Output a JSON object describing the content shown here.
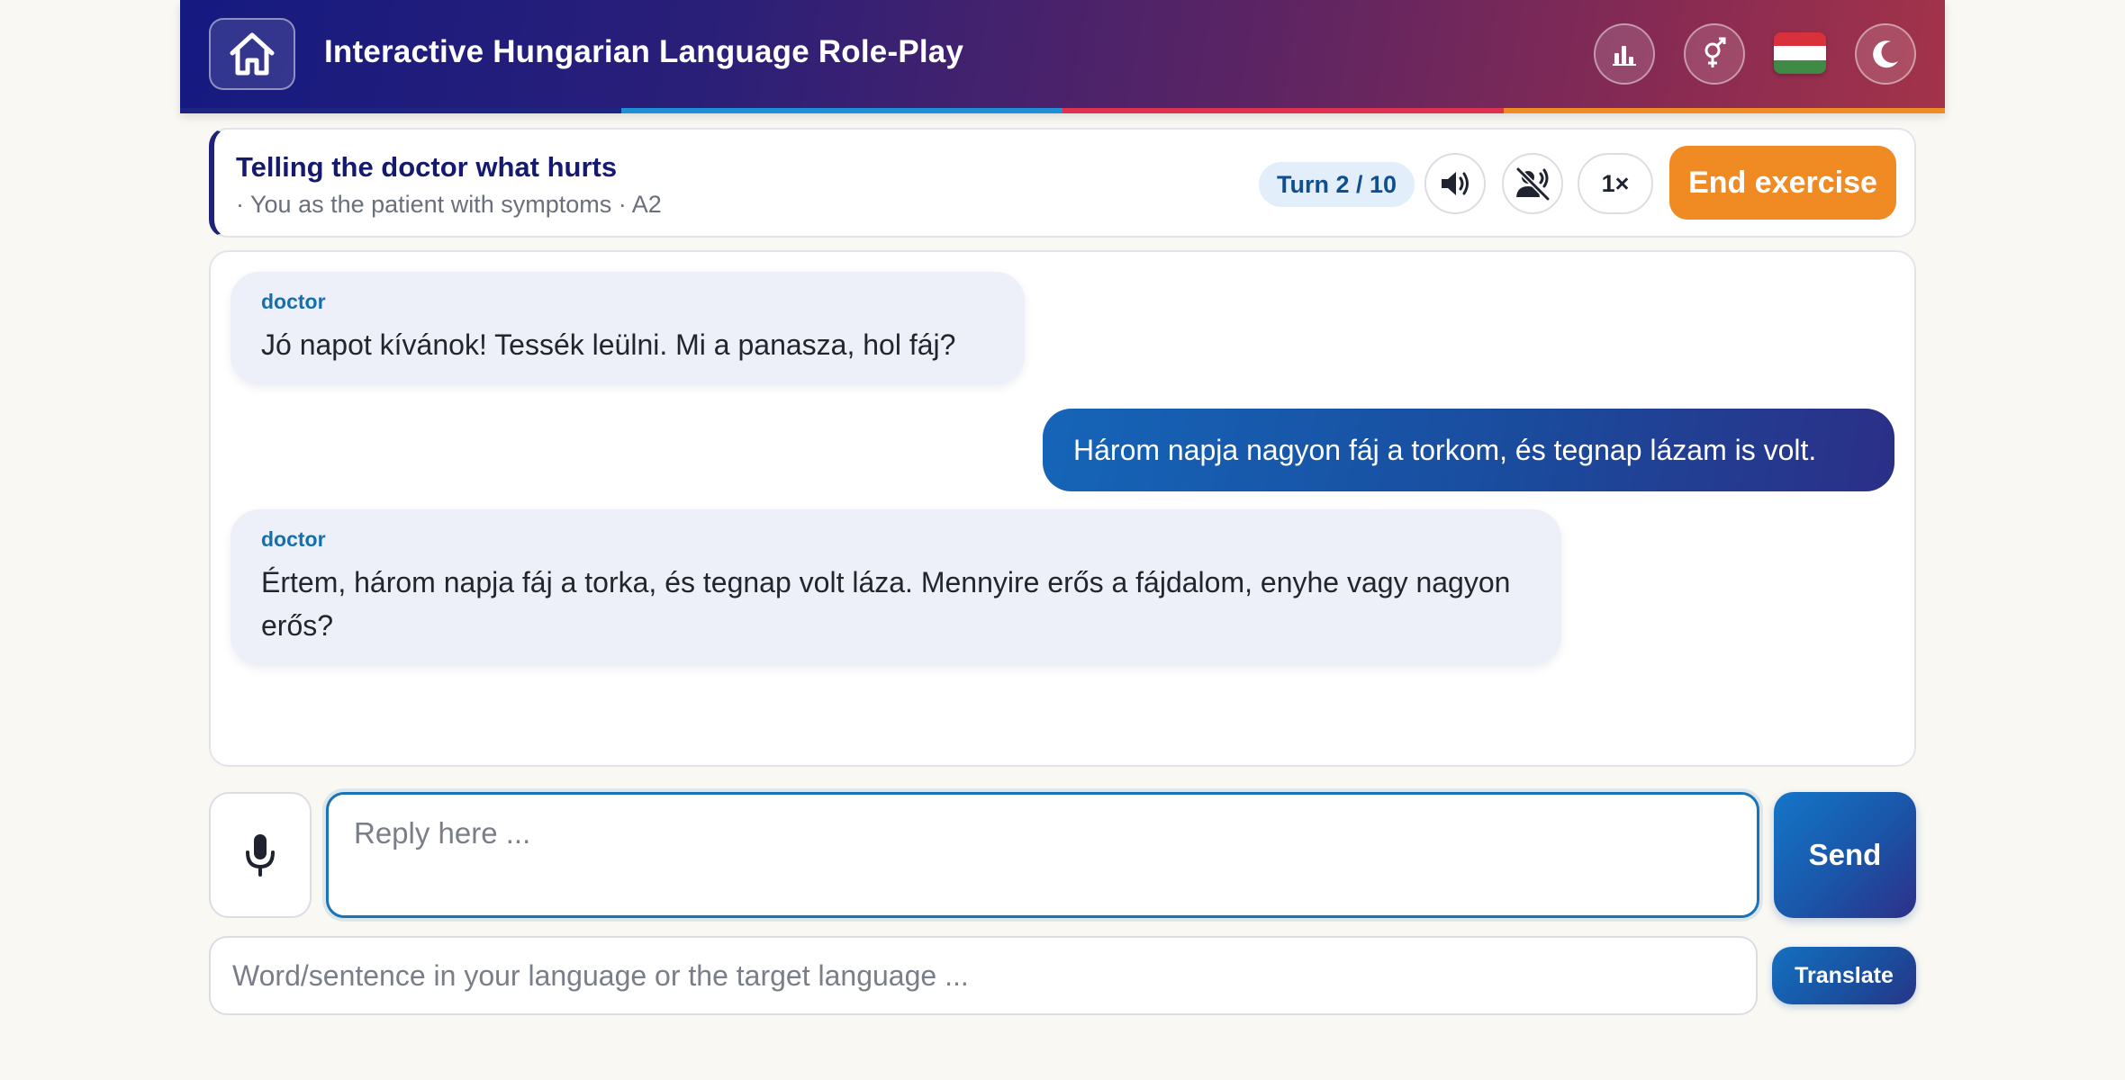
{
  "header": {
    "title": "Interactive Hungarian Language Role-Play",
    "home_icon": "home-icon",
    "stats_icon": "bar-chart-icon",
    "gender_icon": "gender-icon",
    "language_flag": "hungary-flag",
    "theme_icon": "moon-icon",
    "stripe_colors": [
      "#1c2380",
      "#1e8fd6",
      "#e0304f",
      "#f08a22"
    ]
  },
  "scenario": {
    "title": "Telling the doctor what hurts",
    "subtitle": "· You as the patient with symptoms · A2",
    "turn": "Turn 2 / 10",
    "speaker_icon": "speaker-icon",
    "autoplay_off_icon": "mute-voice-icon",
    "speed": "1×",
    "end_label": "End exercise"
  },
  "chat": {
    "messages": [
      {
        "role": "doctor",
        "speaker": "doctor",
        "text": "Jó napot kívánok! Tessék leülni. Mi a panasza, hol fáj?"
      },
      {
        "role": "user",
        "text": "Három napja nagyon fáj a torkom, és tegnap lázam is volt."
      },
      {
        "role": "doctor",
        "speaker": "doctor",
        "text": "Értem, három napja fáj a torka, és tegnap volt láza. Mennyire erős a fájdalom, enyhe vagy nagyon erős?"
      }
    ]
  },
  "input": {
    "mic_icon": "microphone-icon",
    "reply_placeholder": "Reply here ...",
    "send_label": "Send",
    "translate_placeholder": "Word/sentence in your language or the target language ...",
    "translate_label": "Translate"
  },
  "colors": {
    "accent": "#1a72b8",
    "end_button": "#f08a22",
    "header_start": "#151a80",
    "header_end": "#a3334a"
  }
}
